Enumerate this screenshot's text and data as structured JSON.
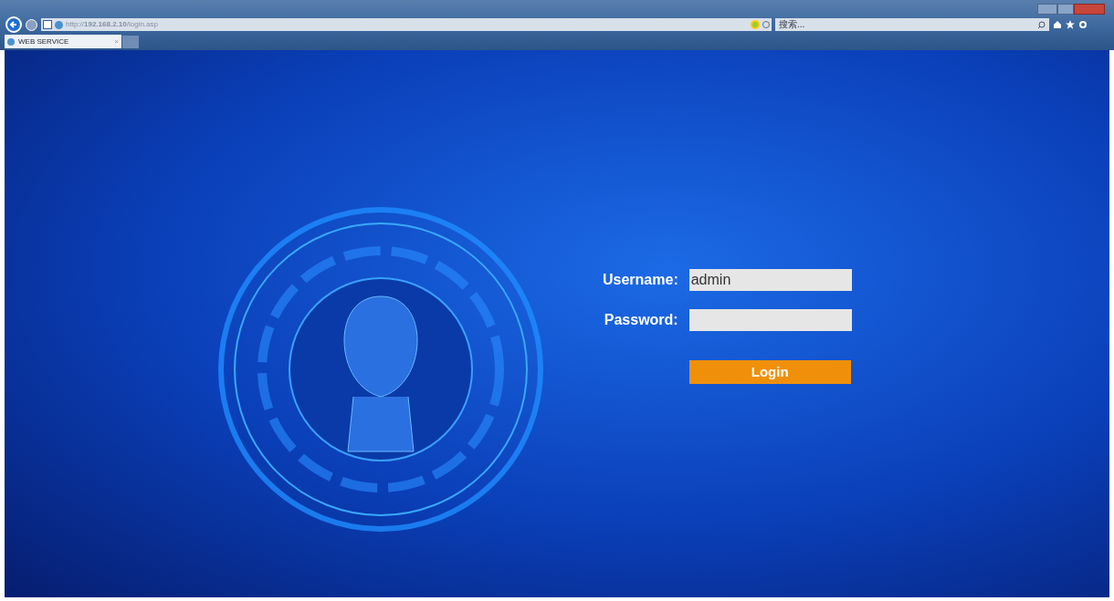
{
  "browser": {
    "address": "http://**192.168.2.10**/login.asp",
    "search_placeholder": "搜索...",
    "tabs": [
      {
        "label": "WEB SERVICE",
        "close": "×",
        "selected": true
      }
    ]
  },
  "login": {
    "fields": [
      {
        "label": "Username:",
        "value": "admin",
        "kind": "text"
      },
      {
        "label": "Password:",
        "kind": "password"
      }
    ],
    "button": "Login"
  }
}
